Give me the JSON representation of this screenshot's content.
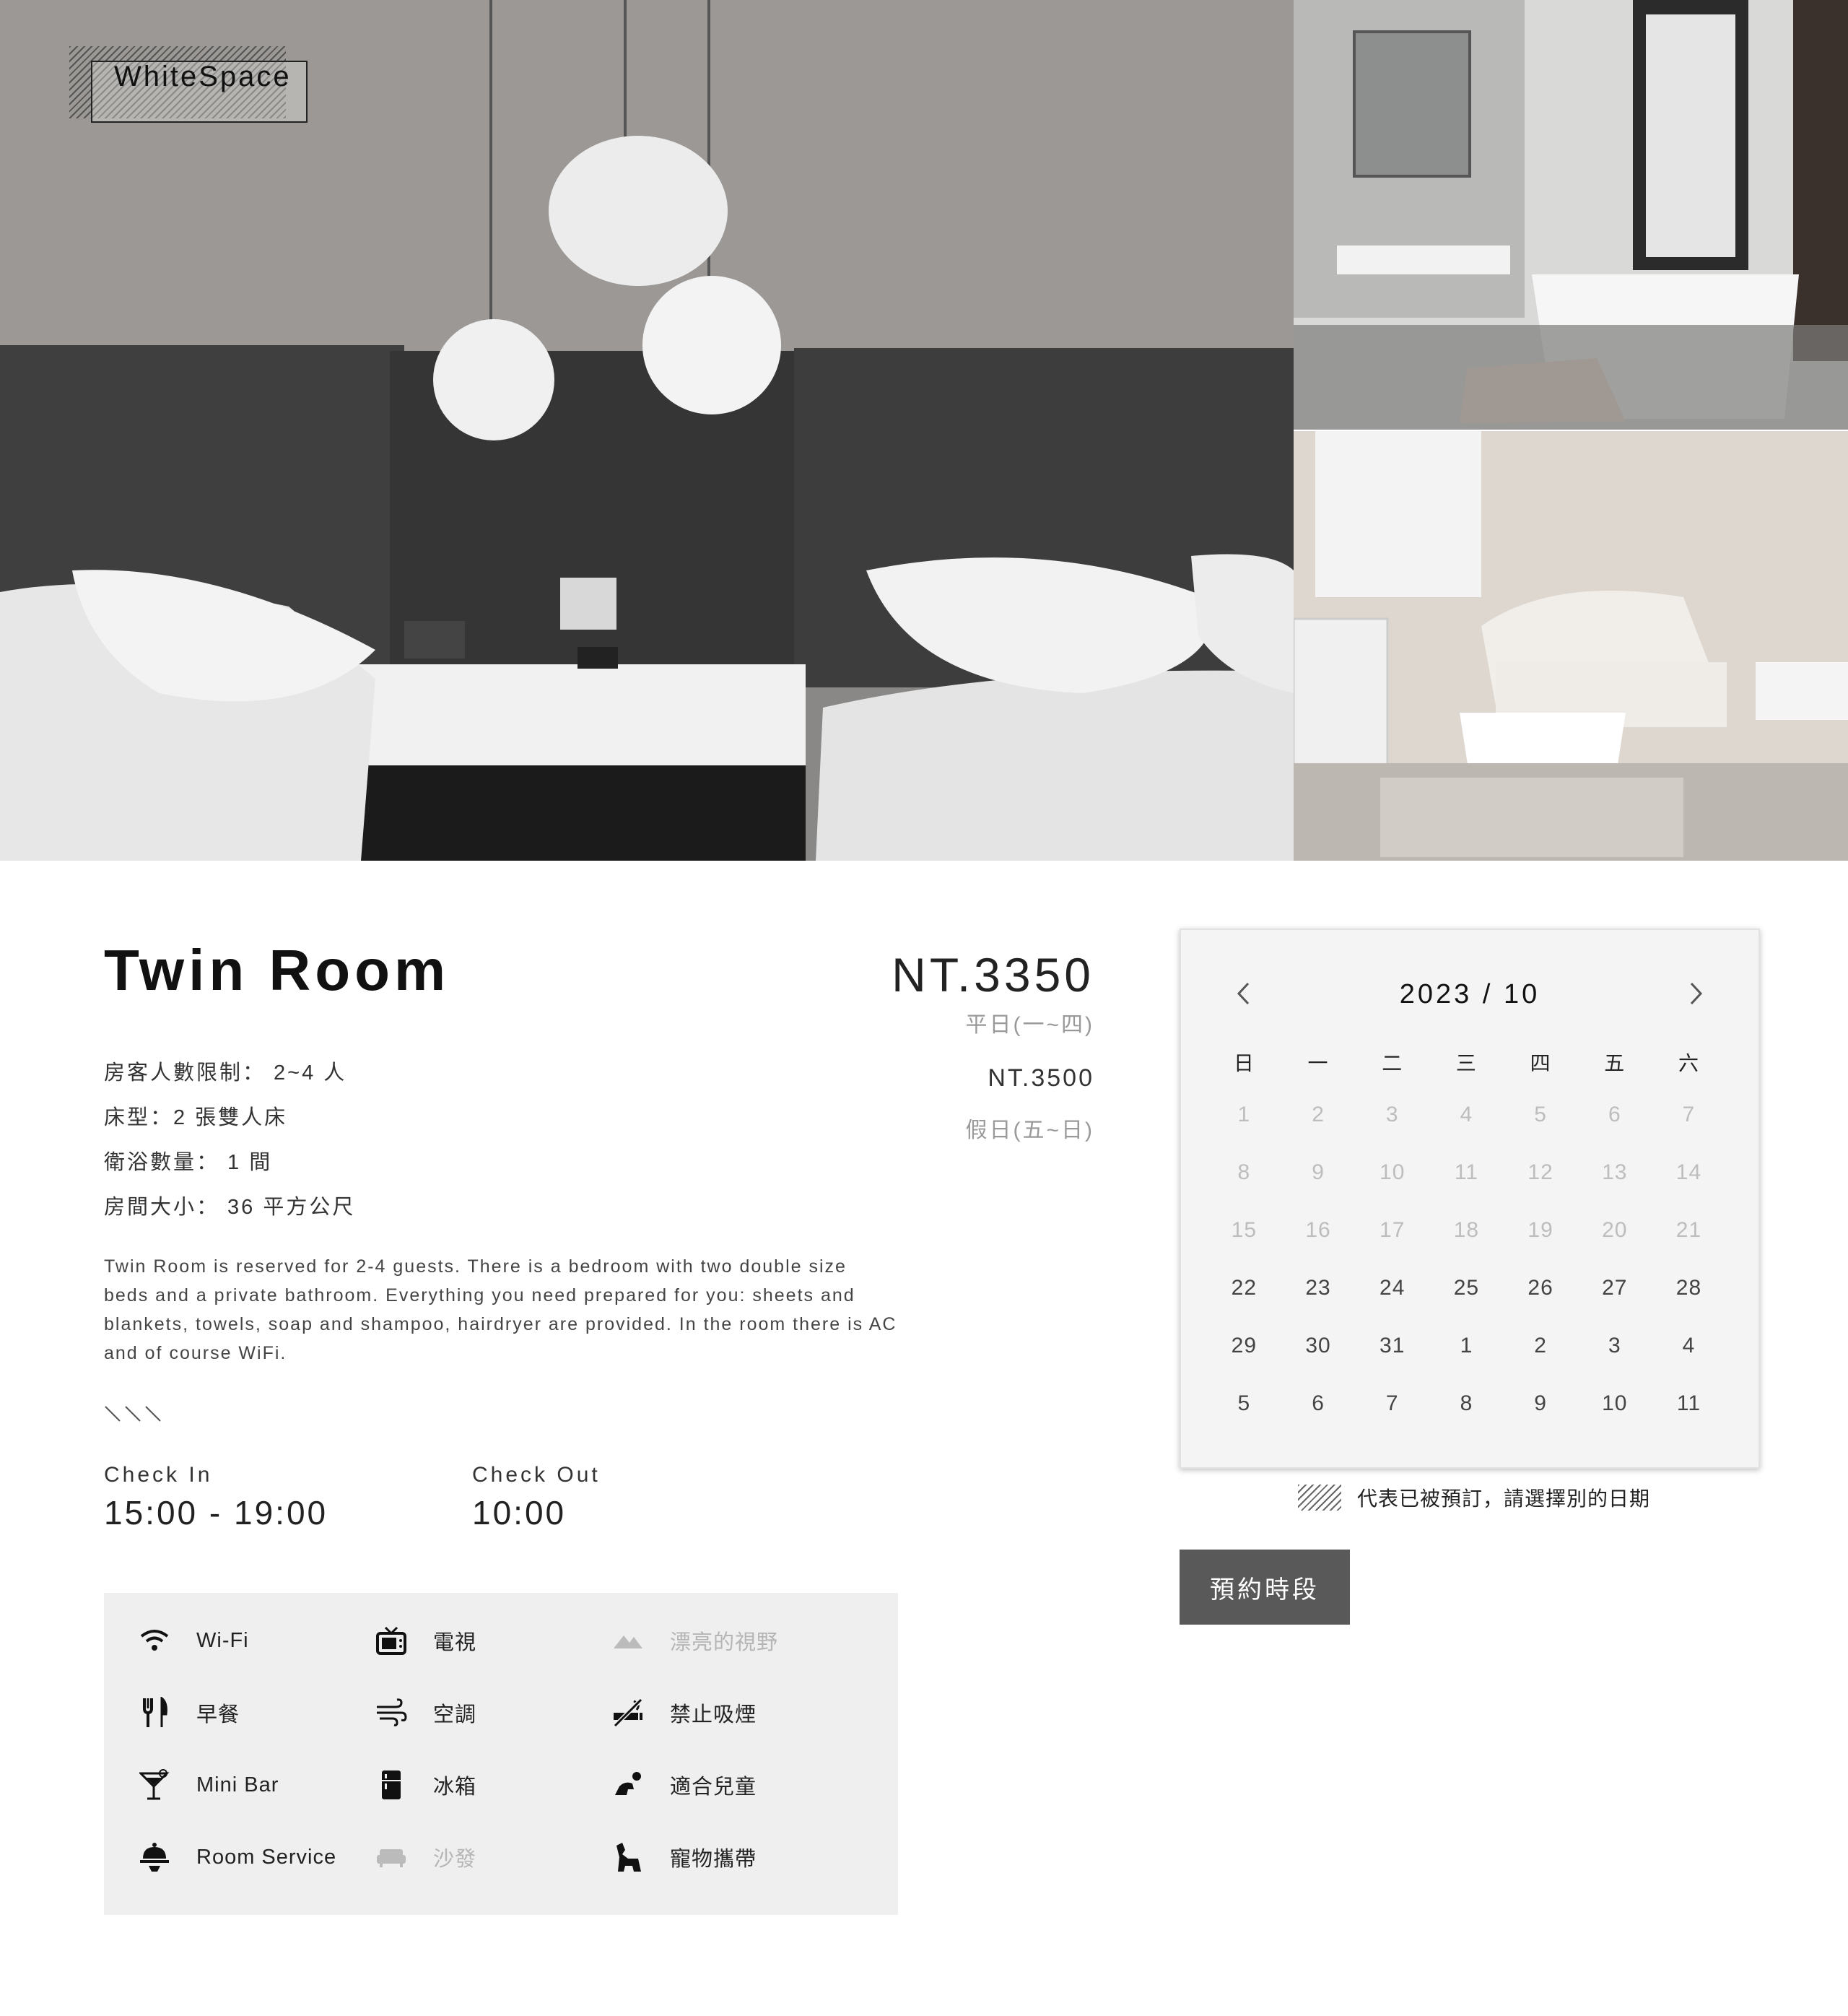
{
  "brand": {
    "name": "WhiteSpace"
  },
  "room": {
    "title": "Twin Room",
    "specs": [
      "房客人數限制： 2~4 人",
      "床型：2 張雙人床",
      "衛浴數量： 1 間",
      "房間大小： 36 平方公尺"
    ],
    "description": "Twin Room is reserved for 2-4 guests. There is a bedroom with two double size beds and a private bathroom. Everything you need prepared for you: sheets and blankets, towels, soap and shampoo, hairdryer are provided. In the room there is AC and of course WiFi.",
    "check_in": {
      "label": "Check In",
      "time": "15:00 - 19:00"
    },
    "check_out": {
      "label": "Check Out",
      "time": "10:00"
    }
  },
  "pricing": {
    "weekday_price": "NT.3350",
    "weekday_label": "平日(一~四)",
    "holiday_price": "NT.3500",
    "holiday_label": "假日(五~日)"
  },
  "amenities": [
    {
      "label": "Wi-Fi",
      "icon": "wifi-icon",
      "available": true
    },
    {
      "label": "電視",
      "icon": "tv-icon",
      "available": true
    },
    {
      "label": "漂亮的視野",
      "icon": "mountain-view-icon",
      "available": false
    },
    {
      "label": "早餐",
      "icon": "fork-knife-icon",
      "available": true
    },
    {
      "label": "空調",
      "icon": "wind-icon",
      "available": true
    },
    {
      "label": "禁止吸煙",
      "icon": "no-smoking-icon",
      "available": true
    },
    {
      "label": "Mini Bar",
      "icon": "cocktail-icon",
      "available": true
    },
    {
      "label": "冰箱",
      "icon": "fridge-icon",
      "available": true
    },
    {
      "label": "適合兒童",
      "icon": "baby-crawl-icon",
      "available": true
    },
    {
      "label": "Room Service",
      "icon": "room-service-icon",
      "available": true
    },
    {
      "label": "沙發",
      "icon": "sofa-icon",
      "available": false
    },
    {
      "label": "寵物攜帶",
      "icon": "pet-icon",
      "available": true
    }
  ],
  "calendar": {
    "title": "2023 /  10",
    "weekdays": [
      "日",
      "一",
      "二",
      "三",
      "四",
      "五",
      "六"
    ],
    "weeks": [
      [
        "1",
        "2",
        "3",
        "4",
        "5",
        "6",
        "7"
      ],
      [
        "8",
        "9",
        "10",
        "11",
        "12",
        "13",
        "14"
      ],
      [
        "15",
        "16",
        "17",
        "18",
        "19",
        "20",
        "21"
      ],
      [
        "22",
        "23",
        "24",
        "25",
        "26",
        "27",
        "28"
      ],
      [
        "29",
        "30",
        "31",
        "1",
        "2",
        "3",
        "4"
      ],
      [
        "5",
        "6",
        "7",
        "8",
        "9",
        "10",
        "11"
      ]
    ],
    "past_weeks": 3,
    "legend_text": "代表已被預訂，請選擇別的日期"
  },
  "booking": {
    "button_label": "預約時段"
  },
  "colors": {
    "button_bg": "#595959",
    "panel_bg": "#efefef",
    "muted": "#bdbdbd"
  }
}
